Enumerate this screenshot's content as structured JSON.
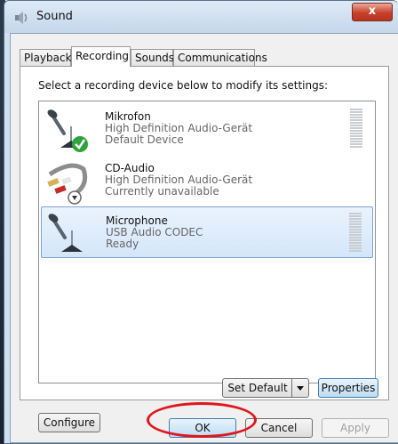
{
  "window": {
    "title": "Sound",
    "close_label": "x"
  },
  "tabs": [
    {
      "label": "Playback"
    },
    {
      "label": "Recording"
    },
    {
      "label": "Sounds"
    },
    {
      "label": "Communications"
    }
  ],
  "instruction": "Select a recording device below to modify its settings:",
  "devices": [
    {
      "name": "Mikrofon",
      "driver": "High Definition Audio-Gerät",
      "status": "Default Device",
      "icon": "microphone-icon",
      "badge": "green-check-icon"
    },
    {
      "name": "CD-Audio",
      "driver": "High Definition Audio-Gerät",
      "status": "Currently unavailable",
      "icon": "cd-audio-cable-icon",
      "badge": "down-arrow-icon"
    },
    {
      "name": "Microphone",
      "driver": "USB Audio CODEC",
      "status": "Ready",
      "icon": "microphone-icon"
    }
  ],
  "buttons": {
    "configure": "Configure",
    "set_default": "Set Default",
    "properties": "Properties",
    "ok": "OK",
    "cancel": "Cancel",
    "apply": "Apply"
  },
  "colors": {
    "highlight_oval": "#e0161d",
    "selection": "#d4e6fa"
  }
}
